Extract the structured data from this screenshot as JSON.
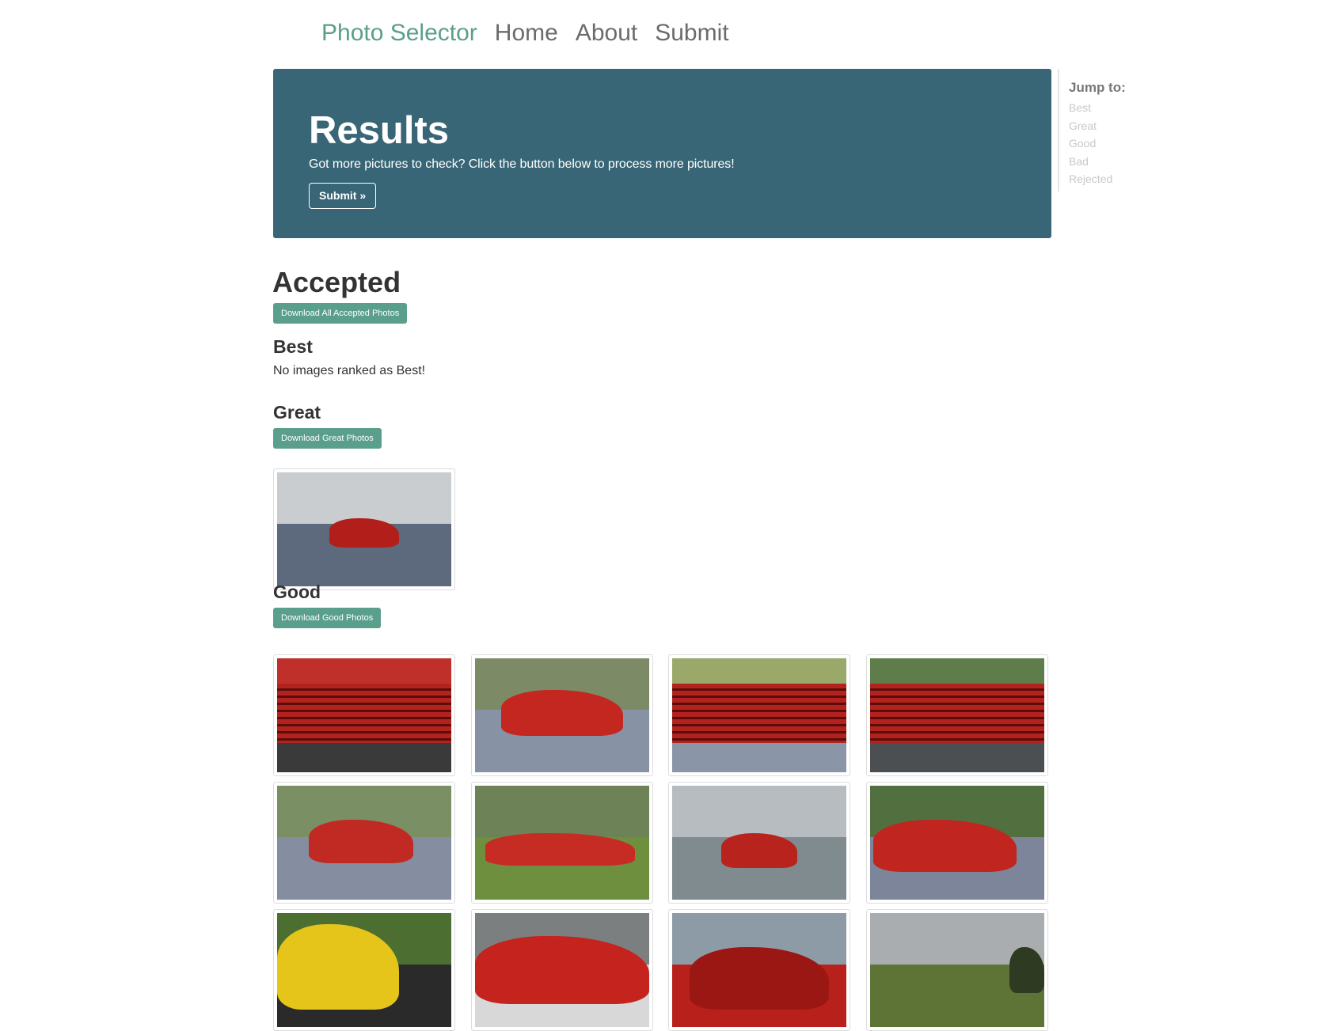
{
  "nav": {
    "brand": "Photo Selector",
    "links": [
      "Home",
      "About",
      "Submit"
    ]
  },
  "hero": {
    "title": "Results",
    "lead": "Got more pictures to check? Click the button below to process more pictures!",
    "button": "Submit »"
  },
  "jump": {
    "title": "Jump to:",
    "items": [
      "Best",
      "Great",
      "Good",
      "Bad",
      "Rejected"
    ]
  },
  "accepted": {
    "title": "Accepted",
    "download_label": "Download All Accepted Photos"
  },
  "best": {
    "title": "Best",
    "empty_text": "No images ranked as Best!"
  },
  "great": {
    "title": "Great",
    "download_label": "Download Great Photos",
    "photos": [
      {
        "name": "great-photo-1",
        "kind": "car-grass"
      }
    ]
  },
  "good": {
    "title": "Good",
    "download_label": "Download Good Photos",
    "photos": [
      {
        "name": "good-photo-1",
        "kind": "grille-close"
      },
      {
        "name": "good-photo-2",
        "kind": "car-house"
      },
      {
        "name": "good-photo-3",
        "kind": "grille-rear"
      },
      {
        "name": "good-photo-4",
        "kind": "grille-rear-crowd"
      },
      {
        "name": "good-photo-5",
        "kind": "car-front"
      },
      {
        "name": "good-photo-6",
        "kind": "car-side"
      },
      {
        "name": "good-photo-7",
        "kind": "car-front-far"
      },
      {
        "name": "good-photo-8",
        "kind": "car-crowd"
      },
      {
        "name": "good-photo-9",
        "kind": "yellow-cockpit"
      },
      {
        "name": "good-photo-10",
        "kind": "race-car"
      },
      {
        "name": "good-photo-11",
        "kind": "gto-rear"
      },
      {
        "name": "good-photo-12",
        "kind": "lawn-overview"
      }
    ]
  },
  "colors": {
    "brand": "#5a9e8c",
    "hero_bg": "#386676",
    "button_bg": "#5a9e8c",
    "nav_link": "#6b6b6b",
    "jump_item": "#c8c8c8"
  }
}
